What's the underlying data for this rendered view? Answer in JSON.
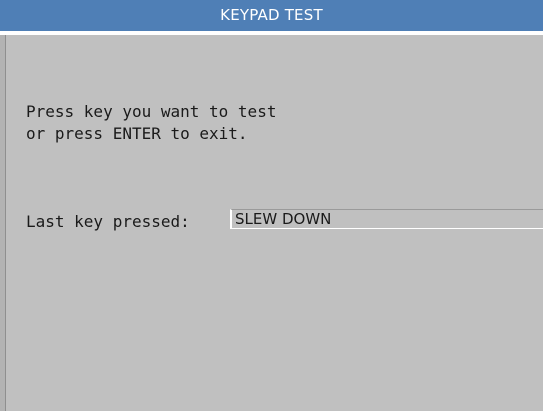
{
  "window": {
    "title": "KEYPAD TEST"
  },
  "instructions": {
    "line1": "Press key you want to test",
    "line2": "or press ENTER to exit."
  },
  "last_key": {
    "label": "Last key pressed:",
    "value": "SLEW DOWN"
  },
  "colors": {
    "title_bar": "#4f7fb6",
    "background": "#c0c0c0",
    "text": "#1a1a1a"
  }
}
